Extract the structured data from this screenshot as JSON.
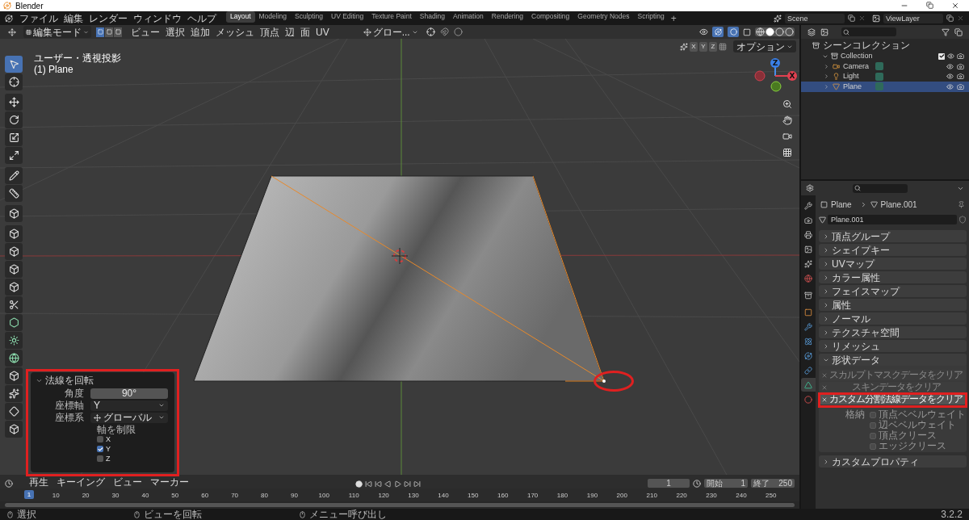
{
  "window": {
    "title": "Blender"
  },
  "menu": [
    "ファイル",
    "編集",
    "レンダー",
    "ウィンドウ",
    "ヘルプ"
  ],
  "workspaces": [
    {
      "label": "Layout",
      "selected": true
    },
    {
      "label": "Modeling",
      "selected": false
    },
    {
      "label": "Sculpting",
      "selected": false
    },
    {
      "label": "UV Editing",
      "selected": false
    },
    {
      "label": "Texture Paint",
      "selected": false
    },
    {
      "label": "Shading",
      "selected": false
    },
    {
      "label": "Animation",
      "selected": false
    },
    {
      "label": "Rendering",
      "selected": false
    },
    {
      "label": "Compositing",
      "selected": false
    },
    {
      "label": "Geometry Nodes",
      "selected": false
    },
    {
      "label": "Scripting",
      "selected": false
    }
  ],
  "add_workspace": "+",
  "scene": "Scene",
  "view_layer": "ViewLayer",
  "viewport_header": {
    "mode": "編集モード",
    "select_modes": [
      {
        "selected": true
      },
      {
        "selected": false
      },
      {
        "selected": false
      }
    ],
    "menus": [
      "ビュー",
      "選択",
      "追加",
      "メッシュ",
      "頂点",
      "辺",
      "面",
      "UV"
    ],
    "orientation": "グロー...",
    "axes": [
      "X",
      "Y",
      "Z"
    ],
    "options": "オプション"
  },
  "viewport": {
    "view_name": "ユーザー・透視投影",
    "object": "(1) Plane",
    "gizmo_labels": [
      "Z",
      "X"
    ],
    "tools": [
      {
        "selected": true
      },
      {
        "selected": false
      },
      {
        "selected": false
      },
      {
        "selected": false
      },
      {
        "selected": false
      },
      {
        "selected": false
      },
      {
        "selected": false
      },
      {
        "selected": false
      },
      {
        "selected": false
      },
      {
        "selected": false
      },
      {
        "selected": false
      },
      {
        "selected": false
      },
      {
        "selected": false
      },
      {
        "selected": false
      },
      {
        "selected": false
      },
      {
        "selected": false
      },
      {
        "selected": false
      },
      {
        "selected": false
      },
      {
        "selected": false
      },
      {
        "selected": false
      },
      {
        "selected": false
      }
    ]
  },
  "operator_panel": {
    "title": "法線を回転",
    "fields": [
      {
        "label": "角度",
        "value": "90°",
        "kind": "slider"
      },
      {
        "label": "座標軸",
        "value": "Y",
        "kind": "dropdown"
      },
      {
        "label": "座標系",
        "value": "グローバル",
        "kind": "orientation"
      }
    ],
    "constraint_label": "軸を制限",
    "axes": [
      {
        "label": "X",
        "checked": false
      },
      {
        "label": "Y",
        "checked": true
      },
      {
        "label": "Z",
        "checked": false
      }
    ]
  },
  "outliner": {
    "root": "シーンコレクション",
    "items": [
      {
        "name": "Collection",
        "expanded": true,
        "checked": true,
        "selected": false,
        "children": [
          {
            "name": "Camera",
            "kind": "camera",
            "expanded": false,
            "selected": false
          },
          {
            "name": "Light",
            "kind": "light",
            "expanded": false,
            "selected": false
          },
          {
            "name": "Plane",
            "kind": "mesh",
            "expanded": false,
            "selected": true
          }
        ]
      }
    ]
  },
  "properties": {
    "tabs": [
      {
        "selected": false
      },
      {
        "selected": false
      },
      {
        "selected": false
      },
      {
        "selected": false
      },
      {
        "selected": false
      },
      {
        "selected": false
      },
      {
        "selected": false
      },
      {
        "selected": false
      },
      {
        "selected": false
      },
      {
        "selected": false
      },
      {
        "selected": false
      },
      {
        "selected": false
      },
      {
        "selected": true
      },
      {
        "selected": false
      }
    ],
    "breadcrumb": [
      "Plane",
      "Plane.001"
    ],
    "mesh_name": "Plane.001",
    "panels": [
      {
        "title": "頂点グループ",
        "expanded": false
      },
      {
        "title": "シェイプキー",
        "expanded": false
      },
      {
        "title": "UVマップ",
        "expanded": false
      },
      {
        "title": "カラー属性",
        "expanded": false
      },
      {
        "title": "フェイスマップ",
        "expanded": false
      },
      {
        "title": "属性",
        "expanded": false
      },
      {
        "title": "ノーマル",
        "expanded": false
      },
      {
        "title": "テクスチャ空間",
        "expanded": false
      },
      {
        "title": "リメッシュ",
        "expanded": false
      },
      {
        "title": "形状データ",
        "expanded": true,
        "buttons": [
          {
            "label": "スカルプトマスクデータをクリア",
            "disabled": true
          },
          {
            "label": "スキンデータをクリア",
            "disabled": true
          },
          {
            "label": "カスタム分割法線データをクリア",
            "disabled": false
          }
        ],
        "storage_label": "格納",
        "options": [
          {
            "label": "頂点ベベルウェイト",
            "checked": false
          },
          {
            "label": "辺ベベルウェイト",
            "checked": false
          },
          {
            "label": "頂点クリース",
            "checked": false
          },
          {
            "label": "エッジクリース",
            "checked": false
          }
        ]
      },
      {
        "title": "カスタムプロパティ",
        "expanded": false
      }
    ]
  },
  "timeline": {
    "menus": [
      "再生",
      "キーイング",
      "ビュー",
      "マーカー"
    ],
    "current_frame": "1",
    "start_label": "開始",
    "start": "1",
    "end_label": "終了",
    "end": "250",
    "ruler_current": "1",
    "ruler_ticks": [
      "10",
      "20",
      "30",
      "40",
      "50",
      "60",
      "70",
      "80",
      "90",
      "100",
      "110",
      "120",
      "130",
      "140",
      "150",
      "160",
      "170",
      "180",
      "190",
      "200",
      "210",
      "220",
      "230",
      "240",
      "250"
    ]
  },
  "status_bar": {
    "items": [
      "選択",
      "ビューを回転",
      "メニュー呼び出し"
    ],
    "version": "3.2.2"
  }
}
